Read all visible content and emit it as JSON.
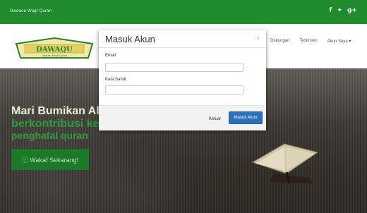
{
  "topbar": {
    "title": "Dawaou Wagf Quran",
    "social": [
      "f",
      "✦",
      "g+"
    ]
  },
  "navbar": {
    "logo_main": "DAWAQU",
    "logo_sub": "Dawaa Waqfi Quran",
    "links": [
      "Dukungan",
      "Testimoni",
      "Akun Saya ▾"
    ]
  },
  "hero": {
    "line1": "Mari Bumikan Al Q",
    "line2": "berkontribusi kep",
    "line3": "penghafal quran",
    "cta": "ⓘ Wakaf Sekarang!"
  },
  "modal": {
    "title": "Masuk Akun",
    "close": "×",
    "email_label": "Email",
    "email_value": "",
    "password_label": "Kata Sandi",
    "password_value": "",
    "keluar_label": "Keluar",
    "masuk_label": "Masuk Akun"
  },
  "colors": {
    "brand_green": "#1f8a2e",
    "primary_blue": "#2d72b8"
  }
}
